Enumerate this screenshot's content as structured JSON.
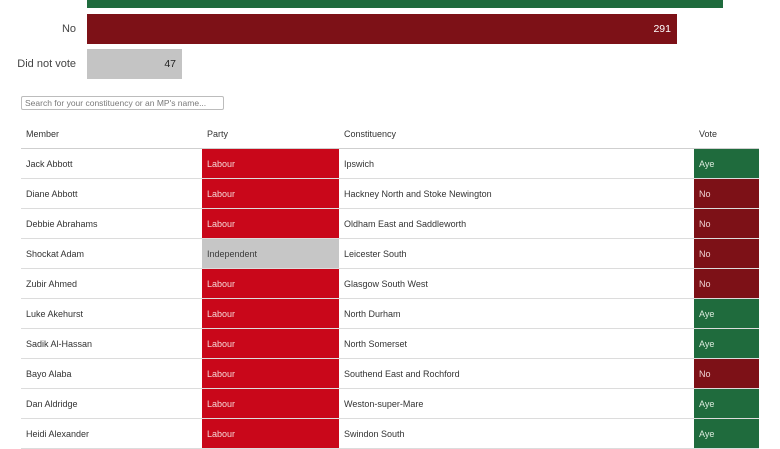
{
  "colors": {
    "aye": "#1f6b3d",
    "no": "#7d1117",
    "did_not_vote": "#c4c4c4",
    "labour": "#c9071a",
    "independent": "#c6c6c6"
  },
  "results": {
    "bars": [
      {
        "label": "",
        "value": "",
        "vote": "aye",
        "count": null
      },
      {
        "label": "No",
        "value": "291",
        "vote": "no",
        "count": 291
      },
      {
        "label": "Did not vote",
        "value": "47",
        "vote": "did_not_vote",
        "count": 47
      }
    ]
  },
  "search": {
    "placeholder": "Search for your constituency or an MP's name..."
  },
  "table": {
    "headers": {
      "member": "Member",
      "party": "Party",
      "constituency": "Constituency",
      "vote": "Vote"
    },
    "rows": [
      {
        "member": "Jack Abbott",
        "party": "Labour",
        "constituency": "Ipswich",
        "vote": "Aye"
      },
      {
        "member": "Diane Abbott",
        "party": "Labour",
        "constituency": "Hackney North and Stoke Newington",
        "vote": "No"
      },
      {
        "member": "Debbie Abrahams",
        "party": "Labour",
        "constituency": "Oldham East and Saddleworth",
        "vote": "No"
      },
      {
        "member": "Shockat Adam",
        "party": "Independent",
        "constituency": "Leicester South",
        "vote": "No"
      },
      {
        "member": "Zubir Ahmed",
        "party": "Labour",
        "constituency": "Glasgow South West",
        "vote": "No"
      },
      {
        "member": "Luke Akehurst",
        "party": "Labour",
        "constituency": "North Durham",
        "vote": "Aye"
      },
      {
        "member": "Sadik Al-Hassan",
        "party": "Labour",
        "constituency": "North Somerset",
        "vote": "Aye"
      },
      {
        "member": "Bayo Alaba",
        "party": "Labour",
        "constituency": "Southend East and Rochford",
        "vote": "No"
      },
      {
        "member": "Dan Aldridge",
        "party": "Labour",
        "constituency": "Weston-super-Mare",
        "vote": "Aye"
      },
      {
        "member": "Heidi Alexander",
        "party": "Labour",
        "constituency": "Swindon South",
        "vote": "Aye"
      }
    ]
  }
}
